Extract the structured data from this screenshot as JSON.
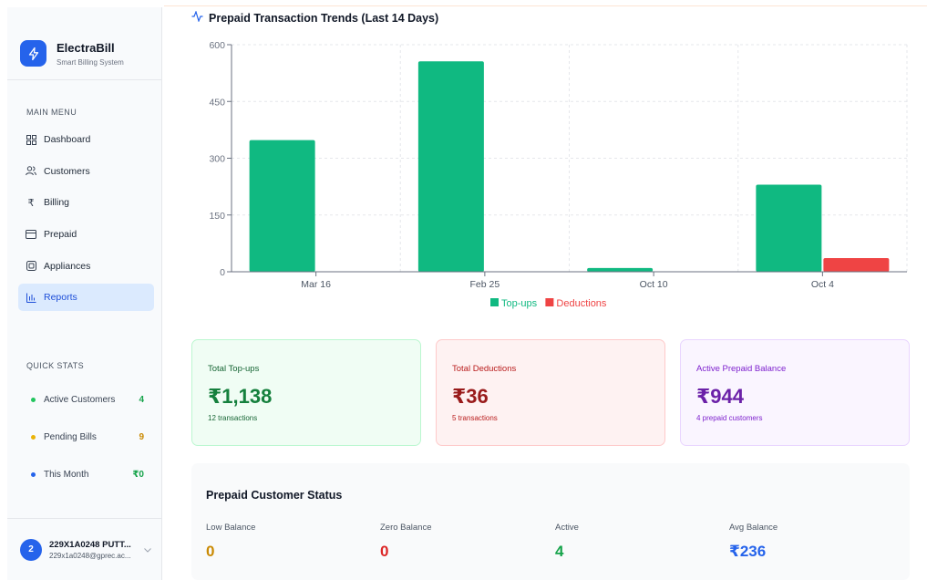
{
  "brand": {
    "name": "ElectraBill",
    "subtitle": "Smart Billing System"
  },
  "sidebar": {
    "main_menu_label": "MAIN MENU",
    "items": [
      {
        "label": "Dashboard",
        "icon": "dashboard-grid-icon"
      },
      {
        "label": "Customers",
        "icon": "users-icon"
      },
      {
        "label": "Billing",
        "icon": "rupee-icon"
      },
      {
        "label": "Prepaid",
        "icon": "credit-card-icon"
      },
      {
        "label": "Appliances",
        "icon": "plug-icon"
      },
      {
        "label": "Reports",
        "icon": "bar-chart-icon",
        "active": true
      }
    ],
    "quick_stats_label": "QUICK STATS",
    "quick_stats": [
      {
        "label": "Active Customers",
        "value": "4",
        "color": "#22c55e"
      },
      {
        "label": "Pending Bills",
        "value": "9",
        "color": "#eab308"
      },
      {
        "label": "This Month",
        "value": "₹0",
        "color": "#2563eb"
      }
    ]
  },
  "user": {
    "initial": "2",
    "name": "229X1A0248 PUTT...",
    "email": "229x1a0248@gprec.ac..."
  },
  "chart_section": {
    "title": "Prepaid Transaction Trends (Last 14 Days)"
  },
  "chart_data": {
    "type": "bar",
    "categories": [
      "Mar 16",
      "Feb 25",
      "Oct 10",
      "Oct 4"
    ],
    "series": [
      {
        "name": "Top-ups",
        "values": [
          348,
          556,
          10,
          230
        ],
        "color": "#10b981"
      },
      {
        "name": "Deductions",
        "values": [
          0,
          0,
          0,
          36
        ],
        "color": "#ef4444"
      }
    ],
    "y_ticks": [
      "0",
      "150",
      "300",
      "450",
      "600"
    ],
    "ylim": [
      0,
      600
    ],
    "grid": true,
    "legend": "bottom"
  },
  "cards": [
    {
      "label": "Total Top-ups",
      "value": "₹1,138",
      "sub": "12 transactions",
      "fg": "#15803d",
      "label_fg": "#166534",
      "bg": "#f0fdf4",
      "border": "#bbf7d0"
    },
    {
      "label": "Total Deductions",
      "value": "₹36",
      "sub": "5 transactions",
      "fg": "#991b1b",
      "label_fg": "#b91c1c",
      "bg": "#fef2f2",
      "border": "#fecaca"
    },
    {
      "label": "Active Prepaid Balance",
      "value": "₹944",
      "sub": "4 prepaid customers",
      "fg": "#6b21a8",
      "label_fg": "#7e22ce",
      "bg": "#faf5ff",
      "border": "#e9d5ff"
    }
  ],
  "status": {
    "title": "Prepaid Customer Status",
    "items": [
      {
        "label": "Low Balance",
        "value": "0",
        "color": "#ca8a04"
      },
      {
        "label": "Zero Balance",
        "value": "0",
        "color": "#dc2626"
      },
      {
        "label": "Active",
        "value": "4",
        "color": "#16a34a"
      },
      {
        "label": "Avg Balance",
        "value": "₹236",
        "color": "#2563eb"
      }
    ]
  }
}
